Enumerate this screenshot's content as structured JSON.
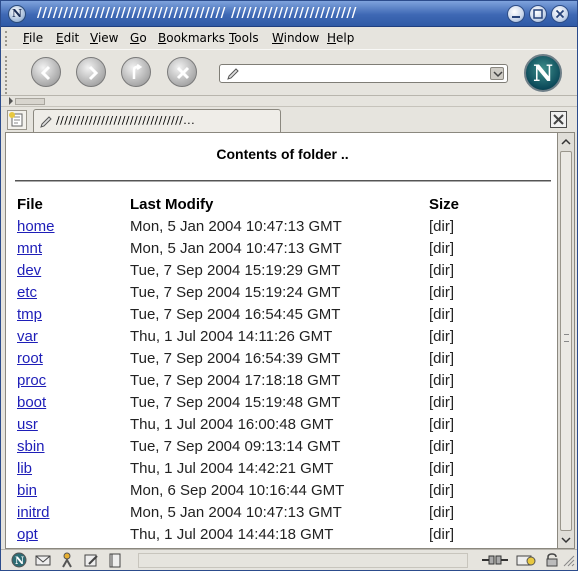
{
  "window": {
    "title": "//////////////////////////////////// ////////////////////////"
  },
  "menu": [
    {
      "label": "File",
      "key": "F",
      "rest": "ile"
    },
    {
      "label": "Edit",
      "key": "E",
      "rest": "dit"
    },
    {
      "label": "View",
      "key": "V",
      "rest": "iew"
    },
    {
      "label": "Go",
      "key": "G",
      "rest": "o"
    },
    {
      "label": "Bookmarks",
      "key": "B",
      "rest": "ookmarks"
    },
    {
      "label": "Tools",
      "key": "T",
      "rest": "ools"
    },
    {
      "label": "Window",
      "key": "W",
      "rest": "indow"
    },
    {
      "label": "Help",
      "key": "H",
      "rest": "elp"
    }
  ],
  "toolbar": {
    "buttons": [
      "back-icon",
      "forward-icon",
      "reload-icon",
      "stop-icon"
    ],
    "url_value": "",
    "logo_letter": "N"
  },
  "tab": {
    "label": "///////////////////////////////..."
  },
  "page": {
    "heading": "Contents of folder ..",
    "columns": {
      "file": "File",
      "modified": "Last Modify",
      "size": "Size"
    },
    "rows": [
      {
        "name": "home",
        "modified": "Mon, 5 Jan 2004 10:47:13 GMT",
        "size": "[dir]"
      },
      {
        "name": "mnt",
        "modified": "Mon, 5 Jan 2004 10:47:13 GMT",
        "size": "[dir]"
      },
      {
        "name": "dev",
        "modified": "Tue, 7 Sep 2004 15:19:29 GMT",
        "size": "[dir]"
      },
      {
        "name": "etc",
        "modified": "Tue, 7 Sep 2004 15:19:24 GMT",
        "size": "[dir]"
      },
      {
        "name": "tmp",
        "modified": "Tue, 7 Sep 2004 16:54:45 GMT",
        "size": "[dir]"
      },
      {
        "name": "var",
        "modified": "Thu, 1 Jul 2004 14:11:26 GMT",
        "size": "[dir]"
      },
      {
        "name": "root",
        "modified": "Tue, 7 Sep 2004 16:54:39 GMT",
        "size": "[dir]"
      },
      {
        "name": "proc",
        "modified": "Tue, 7 Sep 2004 17:18:18 GMT",
        "size": "[dir]"
      },
      {
        "name": "boot",
        "modified": "Tue, 7 Sep 2004 15:19:48 GMT",
        "size": "[dir]"
      },
      {
        "name": "usr",
        "modified": "Thu, 1 Jul 2004 16:00:48 GMT",
        "size": "[dir]"
      },
      {
        "name": "sbin",
        "modified": "Tue, 7 Sep 2004 09:13:14 GMT",
        "size": "[dir]"
      },
      {
        "name": "lib",
        "modified": "Thu, 1 Jul 2004 14:42:21 GMT",
        "size": "[dir]"
      },
      {
        "name": "bin",
        "modified": "Mon, 6 Sep 2004 10:16:44 GMT",
        "size": "[dir]"
      },
      {
        "name": "initrd",
        "modified": "Mon, 5 Jan 2004 10:47:13 GMT",
        "size": "[dir]"
      },
      {
        "name": "opt",
        "modified": "Thu, 1 Jul 2004 14:44:18 GMT",
        "size": "[dir]"
      }
    ]
  },
  "status": {
    "text": ""
  },
  "colors": {
    "title_bar": "#3e68b4",
    "link": "#1e1eb8",
    "chrome": "#e6e4de"
  }
}
